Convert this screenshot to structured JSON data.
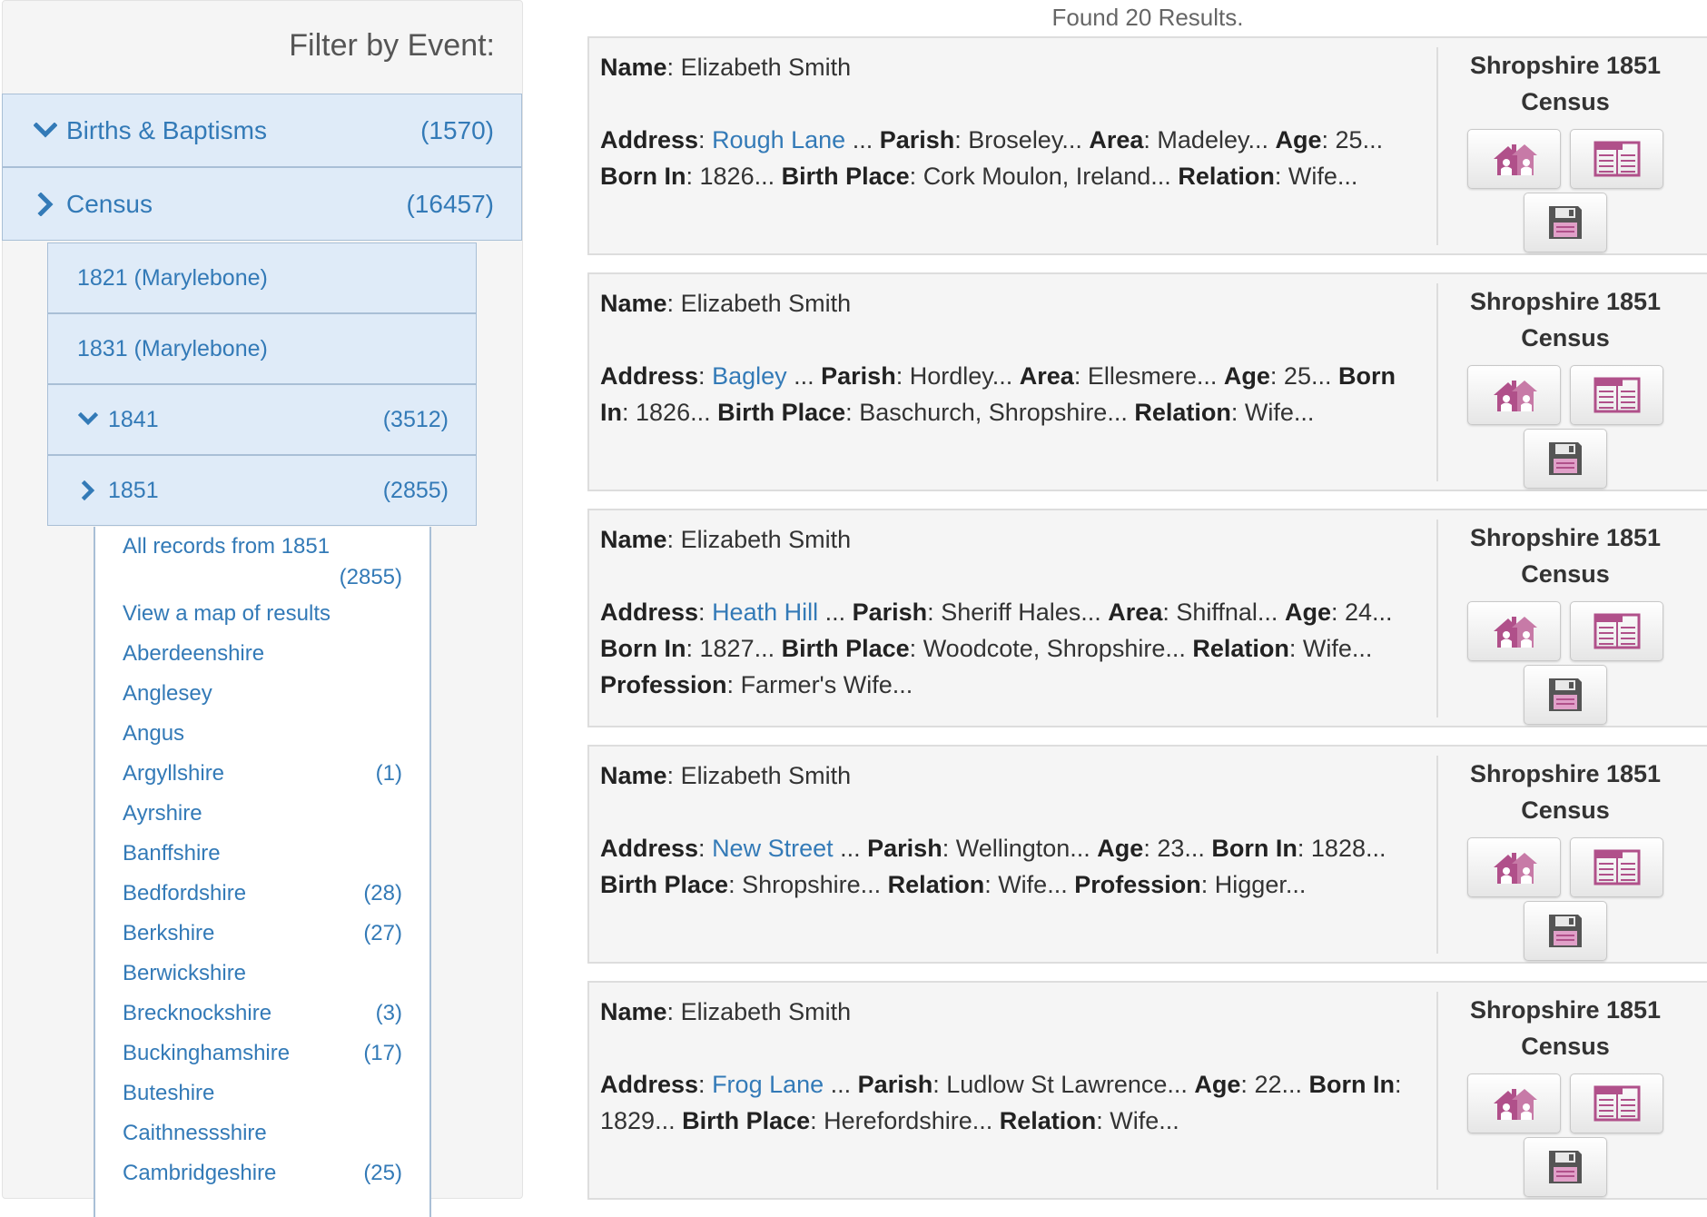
{
  "sidebar": {
    "title": "Filter by Event:",
    "top_items": [
      {
        "label": "Births & Baptisms",
        "count": "(1570)"
      },
      {
        "label": "Census",
        "count": "(16457)"
      }
    ],
    "census_items": [
      {
        "label": "1821 (Marylebone)",
        "count": ""
      },
      {
        "label": "1831 (Marylebone)",
        "count": ""
      },
      {
        "label": "1841",
        "count": "(3512)"
      },
      {
        "label": "1851",
        "count": "(2855)"
      }
    ],
    "all_records": {
      "label": "All records from 1851",
      "count": "(2855)"
    },
    "map_link": "View a map of results",
    "counties": [
      {
        "label": "Aberdeenshire",
        "count": ""
      },
      {
        "label": "Anglesey",
        "count": ""
      },
      {
        "label": "Angus",
        "count": ""
      },
      {
        "label": "Argyllshire",
        "count": "(1)"
      },
      {
        "label": "Ayrshire",
        "count": ""
      },
      {
        "label": "Banffshire",
        "count": ""
      },
      {
        "label": "Bedfordshire",
        "count": "(28)"
      },
      {
        "label": "Berkshire",
        "count": "(27)"
      },
      {
        "label": "Berwickshire",
        "count": ""
      },
      {
        "label": "Brecknockshire",
        "count": "(3)"
      },
      {
        "label": "Buckinghamshire",
        "count": "(17)"
      },
      {
        "label": "Buteshire",
        "count": ""
      },
      {
        "label": "Caithnessshire",
        "count": ""
      },
      {
        "label": "Cambridgeshire",
        "count": "(25)"
      }
    ]
  },
  "results": {
    "header": "Found 20 Results.",
    "labels": {
      "name": "Name",
      "address": "Address",
      "parish": "Parish",
      "area": "Area",
      "age": "Age",
      "born_in": "Born In",
      "birth_place": "Birth Place",
      "relation": "Relation",
      "profession": "Profession"
    },
    "cards": [
      {
        "name": "Elizabeth Smith",
        "address": "Rough Lane",
        "parish": "Broseley...",
        "area": "Madeley...",
        "age": "25...",
        "born_in": "1826...",
        "birth_place": "Cork Moulon, Ireland...",
        "relation": "Wife...",
        "profession": "",
        "source_line1": "Shropshire 1851",
        "source_line2": "Census"
      },
      {
        "name": "Elizabeth Smith",
        "address": "Bagley",
        "parish": "Hordley...",
        "area": "Ellesmere...",
        "age": "25...",
        "born_in": "1826...",
        "birth_place": "Baschurch, Shropshire...",
        "relation": "Wife...",
        "profession": "",
        "source_line1": "Shropshire 1851",
        "source_line2": "Census"
      },
      {
        "name": "Elizabeth Smith",
        "address": "Heath Hill",
        "parish": "Sheriff Hales...",
        "area": "Shiffnal...",
        "age": "24...",
        "born_in": "1827...",
        "birth_place": "Woodcote, Shropshire...",
        "relation": "Wife...",
        "profession": "Farmer's Wife...",
        "source_line1": "Shropshire 1851",
        "source_line2": "Census"
      },
      {
        "name": "Elizabeth Smith",
        "address": "New Street",
        "parish": "Wellington...",
        "area": "",
        "age": "23...",
        "born_in": "1828...",
        "birth_place": "Shropshire...",
        "relation": "Wife...",
        "profession": "Higger...",
        "source_line1": "Shropshire 1851",
        "source_line2": "Census"
      },
      {
        "name": "Elizabeth Smith",
        "address": "Frog Lane",
        "parish": "Ludlow St Lawrence...",
        "area": "",
        "age": "22...",
        "born_in": "1829...",
        "birth_place": "Herefordshire...",
        "relation": "Wife...",
        "profession": "",
        "source_line1": "Shropshire 1851",
        "source_line2": "Census"
      }
    ]
  },
  "colors": {
    "link": "#337ab7",
    "panel_bg": "#f5f5f5",
    "nav_bg": "#dfebf8",
    "icon_pink": "#b0508a"
  },
  "icons": {
    "chevron_down": "chevron-down-icon",
    "chevron_right": "chevron-right-icon",
    "household": "household-icon",
    "transcript": "transcript-icon",
    "save": "save-icon"
  }
}
